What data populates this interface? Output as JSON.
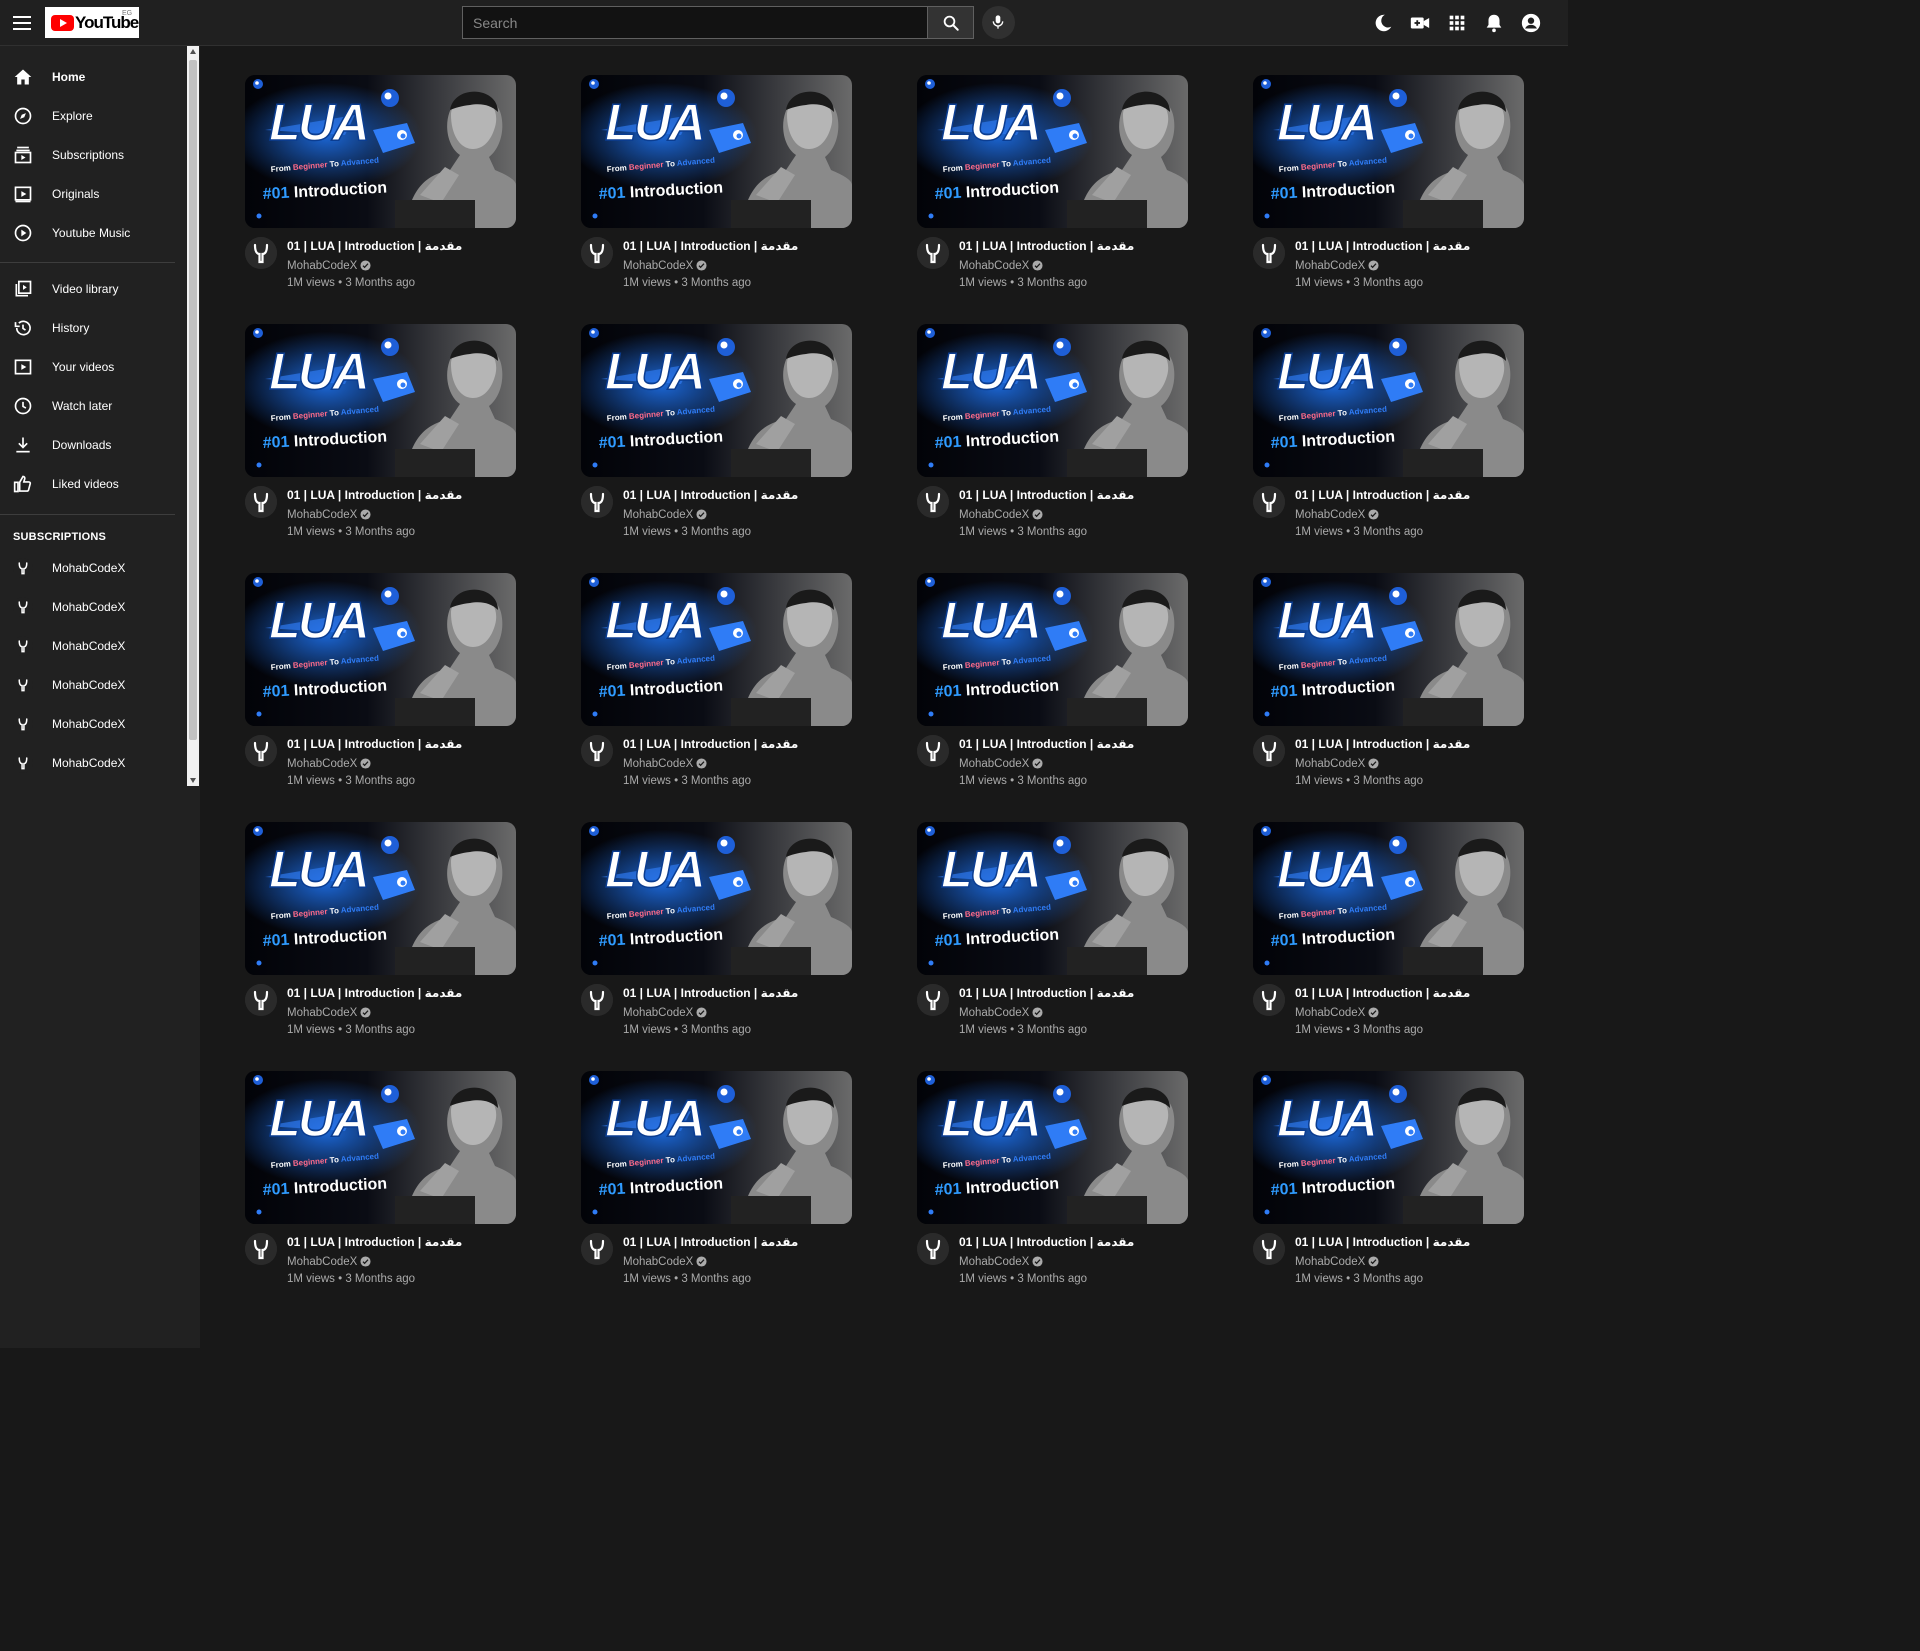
{
  "header": {
    "logo_text": "YouTube",
    "country_code": "EG",
    "search_placeholder": "Search",
    "icons": [
      "menu-icon",
      "search-icon",
      "mic-icon",
      "theme-moon-icon",
      "create-video-icon",
      "apps-grid-icon",
      "notifications-bell-icon",
      "account-icon"
    ]
  },
  "sidebar": {
    "main": [
      {
        "label": "Home",
        "icon": "home-icon",
        "active": true
      },
      {
        "label": "Explore",
        "icon": "compass-icon"
      },
      {
        "label": "Subscriptions",
        "icon": "subscriptions-icon"
      },
      {
        "label": "Originals",
        "icon": "originals-icon"
      },
      {
        "label": "Youtube Music",
        "icon": "music-icon"
      }
    ],
    "library": [
      {
        "label": "Video library",
        "icon": "library-icon"
      },
      {
        "label": "History",
        "icon": "history-icon"
      },
      {
        "label": "Your videos",
        "icon": "your-videos-icon"
      },
      {
        "label": "Watch later",
        "icon": "clock-icon"
      },
      {
        "label": "Downloads",
        "icon": "download-icon"
      },
      {
        "label": "Liked videos",
        "icon": "thumbs-up-icon"
      }
    ],
    "subscriptions_heading": "SUBSCRIPTIONS",
    "subscriptions": [
      {
        "label": "MohabCodeX"
      },
      {
        "label": "MohabCodeX"
      },
      {
        "label": "MohabCodeX"
      },
      {
        "label": "MohabCodeX"
      },
      {
        "label": "MohabCodeX"
      },
      {
        "label": "MohabCodeX"
      }
    ]
  },
  "videos": [
    {
      "title": "01 | LUA | Introduction | مقدمة",
      "channel": "MohabCodeX",
      "meta": "1M views • 3 Months ago",
      "thumb": {
        "brand": "LUA",
        "line1_from": "From",
        "line1_beginner": "Beginner",
        "line1_to": "To",
        "line1_advanced": "Advanced",
        "episode": "#01",
        "topic": "Introduction"
      }
    },
    {
      "title": "01 | LUA | Introduction | مقدمة",
      "channel": "MohabCodeX",
      "meta": "1M views • 3 Months ago",
      "thumb": {
        "brand": "LUA",
        "line1_from": "From",
        "line1_beginner": "Beginner",
        "line1_to": "To",
        "line1_advanced": "Advanced",
        "episode": "#01",
        "topic": "Introduction"
      }
    },
    {
      "title": "01 | LUA | Introduction | مقدمة",
      "channel": "MohabCodeX",
      "meta": "1M views • 3 Months ago",
      "thumb": {
        "brand": "LUA",
        "line1_from": "From",
        "line1_beginner": "Beginner",
        "line1_to": "To",
        "line1_advanced": "Advanced",
        "episode": "#01",
        "topic": "Introduction"
      }
    },
    {
      "title": "01 | LUA | Introduction | مقدمة",
      "channel": "MohabCodeX",
      "meta": "1M views • 3 Months ago",
      "thumb": {
        "brand": "LUA",
        "line1_from": "From",
        "line1_beginner": "Beginner",
        "line1_to": "To",
        "line1_advanced": "Advanced",
        "episode": "#01",
        "topic": "Introduction"
      }
    },
    {
      "title": "01 | LUA | Introduction | مقدمة",
      "channel": "MohabCodeX",
      "meta": "1M views • 3 Months ago",
      "thumb": {
        "brand": "LUA",
        "line1_from": "From",
        "line1_beginner": "Beginner",
        "line1_to": "To",
        "line1_advanced": "Advanced",
        "episode": "#01",
        "topic": "Introduction"
      }
    },
    {
      "title": "01 | LUA | Introduction | مقدمة",
      "channel": "MohabCodeX",
      "meta": "1M views • 3 Months ago",
      "thumb": {
        "brand": "LUA",
        "line1_from": "From",
        "line1_beginner": "Beginner",
        "line1_to": "To",
        "line1_advanced": "Advanced",
        "episode": "#01",
        "topic": "Introduction"
      }
    },
    {
      "title": "01 | LUA | Introduction | مقدمة",
      "channel": "MohabCodeX",
      "meta": "1M views • 3 Months ago",
      "thumb": {
        "brand": "LUA",
        "line1_from": "From",
        "line1_beginner": "Beginner",
        "line1_to": "To",
        "line1_advanced": "Advanced",
        "episode": "#01",
        "topic": "Introduction"
      }
    },
    {
      "title": "01 | LUA | Introduction | مقدمة",
      "channel": "MohabCodeX",
      "meta": "1M views • 3 Months ago",
      "thumb": {
        "brand": "LUA",
        "line1_from": "From",
        "line1_beginner": "Beginner",
        "line1_to": "To",
        "line1_advanced": "Advanced",
        "episode": "#01",
        "topic": "Introduction"
      }
    },
    {
      "title": "01 | LUA | Introduction | مقدمة",
      "channel": "MohabCodeX",
      "meta": "1M views • 3 Months ago",
      "thumb": {
        "brand": "LUA",
        "line1_from": "From",
        "line1_beginner": "Beginner",
        "line1_to": "To",
        "line1_advanced": "Advanced",
        "episode": "#01",
        "topic": "Introduction"
      }
    },
    {
      "title": "01 | LUA | Introduction | مقدمة",
      "channel": "MohabCodeX",
      "meta": "1M views • 3 Months ago",
      "thumb": {
        "brand": "LUA",
        "line1_from": "From",
        "line1_beginner": "Beginner",
        "line1_to": "To",
        "line1_advanced": "Advanced",
        "episode": "#01",
        "topic": "Introduction"
      }
    },
    {
      "title": "01 | LUA | Introduction | مقدمة",
      "channel": "MohabCodeX",
      "meta": "1M views • 3 Months ago",
      "thumb": {
        "brand": "LUA",
        "line1_from": "From",
        "line1_beginner": "Beginner",
        "line1_to": "To",
        "line1_advanced": "Advanced",
        "episode": "#01",
        "topic": "Introduction"
      }
    },
    {
      "title": "01 | LUA | Introduction | مقدمة",
      "channel": "MohabCodeX",
      "meta": "1M views • 3 Months ago",
      "thumb": {
        "brand": "LUA",
        "line1_from": "From",
        "line1_beginner": "Beginner",
        "line1_to": "To",
        "line1_advanced": "Advanced",
        "episode": "#01",
        "topic": "Introduction"
      }
    },
    {
      "title": "01 | LUA | Introduction | مقدمة",
      "channel": "MohabCodeX",
      "meta": "1M views • 3 Months ago",
      "thumb": {
        "brand": "LUA",
        "line1_from": "From",
        "line1_beginner": "Beginner",
        "line1_to": "To",
        "line1_advanced": "Advanced",
        "episode": "#01",
        "topic": "Introduction"
      }
    },
    {
      "title": "01 | LUA | Introduction | مقدمة",
      "channel": "MohabCodeX",
      "meta": "1M views • 3 Months ago",
      "thumb": {
        "brand": "LUA",
        "line1_from": "From",
        "line1_beginner": "Beginner",
        "line1_to": "To",
        "line1_advanced": "Advanced",
        "episode": "#01",
        "topic": "Introduction"
      }
    },
    {
      "title": "01 | LUA | Introduction | مقدمة",
      "channel": "MohabCodeX",
      "meta": "1M views • 3 Months ago",
      "thumb": {
        "brand": "LUA",
        "line1_from": "From",
        "line1_beginner": "Beginner",
        "line1_to": "To",
        "line1_advanced": "Advanced",
        "episode": "#01",
        "topic": "Introduction"
      }
    },
    {
      "title": "01 | LUA | Introduction | مقدمة",
      "channel": "MohabCodeX",
      "meta": "1M views • 3 Months ago",
      "thumb": {
        "brand": "LUA",
        "line1_from": "From",
        "line1_beginner": "Beginner",
        "line1_to": "To",
        "line1_advanced": "Advanced",
        "episode": "#01",
        "topic": "Introduction"
      }
    },
    {
      "title": "01 | LUA | Introduction | مقدمة",
      "channel": "MohabCodeX",
      "meta": "1M views • 3 Months ago",
      "thumb": {
        "brand": "LUA",
        "line1_from": "From",
        "line1_beginner": "Beginner",
        "line1_to": "To",
        "line1_advanced": "Advanced",
        "episode": "#01",
        "topic": "Introduction"
      }
    },
    {
      "title": "01 | LUA | Introduction | مقدمة",
      "channel": "MohabCodeX",
      "meta": "1M views • 3 Months ago",
      "thumb": {
        "brand": "LUA",
        "line1_from": "From",
        "line1_beginner": "Beginner",
        "line1_to": "To",
        "line1_advanced": "Advanced",
        "episode": "#01",
        "topic": "Introduction"
      }
    },
    {
      "title": "01 | LUA | Introduction | مقدمة",
      "channel": "MohabCodeX",
      "meta": "1M views • 3 Months ago",
      "thumb": {
        "brand": "LUA",
        "line1_from": "From",
        "line1_beginner": "Beginner",
        "line1_to": "To",
        "line1_advanced": "Advanced",
        "episode": "#01",
        "topic": "Introduction"
      }
    },
    {
      "title": "01 | LUA | Introduction | مقدمة",
      "channel": "MohabCodeX",
      "meta": "1M views • 3 Months ago",
      "thumb": {
        "brand": "LUA",
        "line1_from": "From",
        "line1_beginner": "Beginner",
        "line1_to": "To",
        "line1_advanced": "Advanced",
        "episode": "#01",
        "topic": "Introduction"
      }
    }
  ],
  "colors": {
    "background": "#181818",
    "topbar": "#202020",
    "sidebar": "#212121",
    "brand_red": "#ff0000",
    "thumb_accent_blue": "#2f7cf6",
    "thumb_accent_pink": "#ff6b8a",
    "secondary_text": "#aaaaaa"
  }
}
